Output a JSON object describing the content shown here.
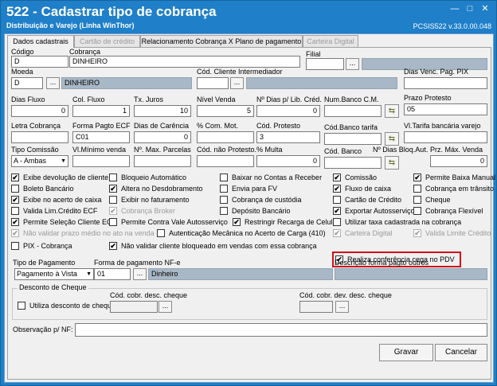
{
  "window": {
    "title": "522 - Cadastrar tipo de cobrança",
    "subtitle": "Distribuição e Varejo (Linha WinThor)",
    "version": "PCSIS522  v.33.0.00.048",
    "minimize": "—",
    "maximize": "□",
    "close": "✕"
  },
  "tabs": [
    "Dados cadastrais",
    "Cartão de crédito",
    "Relacionamento Cobrança X Plano de pagamento",
    "Carteira Digital"
  ],
  "fields": {
    "codigo": {
      "label": "Código",
      "value": "D"
    },
    "cobranca": {
      "label": "Cobrança",
      "value": "DINHEIRO"
    },
    "filial": {
      "label": "Filial",
      "value": ""
    },
    "moeda": {
      "label": "Moeda",
      "value": "D",
      "desc": "DINHEIRO"
    },
    "cod_cliente_inter": {
      "label": "Cód. Cliente Intermediador",
      "value": ""
    },
    "dias_venc": {
      "label": "Dias Venc. Pag. PIX",
      "value": ""
    },
    "dias_fluxo": {
      "label": "Dias Fluxo",
      "value": "0"
    },
    "col_fluxo": {
      "label": "Col. Fluxo",
      "value": "1"
    },
    "tx_juros": {
      "label": "Tx. Juros",
      "value": "10"
    },
    "nivel_venda": {
      "label": "Nível Venda",
      "value": "5"
    },
    "n_dias_lib": {
      "label": "Nº Dias p/ Lib. Créd.",
      "value": "0"
    },
    "num_banco_cm": {
      "label": "Num.Banco C.M.",
      "value": ""
    },
    "prazo_protesto": {
      "label": "Prazo Protesto",
      "value": "05"
    },
    "letra_cobranca": {
      "label": "Letra Cobrança",
      "value": ""
    },
    "forma_pagto_ecf": {
      "label": "Forma Pagto ECF",
      "value": "C01"
    },
    "dias_carencia": {
      "label": "Dias de Carência",
      "value": "0"
    },
    "com_mot": {
      "label": "% Com. Mot.",
      "value": ""
    },
    "cod_protesto": {
      "label": "Cód. Protesto",
      "value": "3"
    },
    "cod_banco_tarifa": {
      "label": "Cód.Banco tarifa",
      "value": ""
    },
    "vl_tarifa": {
      "label": "Vl.Tarifa bancária varejo",
      "value": ""
    },
    "tipo_comissao": {
      "label": "Tipo Comissão",
      "value": "A - Ambas"
    },
    "vl_minimo_venda": {
      "label": "Vl.Mínimo venda",
      "value": ""
    },
    "n_max_parcelas": {
      "label": "Nº. Max. Parcelas",
      "value": ""
    },
    "cod_nao_protesto": {
      "label": "Cód. não Protesto.",
      "value": ""
    },
    "multa": {
      "label": "% Multa",
      "value": "0"
    },
    "cod_banco": {
      "label": "Cód. Banco",
      "value": ""
    },
    "n_dias_bloq": {
      "label": "Nº Dias Bloq.Aut.",
      "value": ""
    },
    "prz_max_venda": {
      "label": "Prz. Máx. Venda",
      "value": "0"
    }
  },
  "checkboxes": [
    {
      "label": "Exibe devolução de cliente",
      "checked": true,
      "disabled": false
    },
    {
      "label": "Boleto Bancário",
      "checked": false,
      "disabled": false
    },
    {
      "label": "Exibe no acerto de caixa",
      "checked": true,
      "disabled": false
    },
    {
      "label": "Valida Lim.Crédito ECF",
      "checked": false,
      "disabled": false
    },
    {
      "label": "Permite Seleção Cliente ECF",
      "checked": true,
      "disabled": false
    },
    {
      "label": "Não validar prazo médio no ato na venda",
      "checked": true,
      "disabled": true
    },
    {
      "label": "PIX - Cobrança",
      "checked": false,
      "disabled": false
    },
    {
      "label": "Bloqueio Automático",
      "checked": false,
      "disabled": false
    },
    {
      "label": "Altera no Desdobramento",
      "checked": true,
      "disabled": false
    },
    {
      "label": "Exibir no faturamento",
      "checked": false,
      "disabled": false
    },
    {
      "label": "Cobrança Broker",
      "checked": true,
      "disabled": true
    },
    {
      "label": "Permite Contra Vale Autosserviço",
      "checked": false,
      "disabled": false
    },
    {
      "label": "Autenticação Mecânica no Acerto de Carga (410)",
      "checked": false,
      "disabled": false
    },
    {
      "label": "Não validar cliente bloqueado em vendas com essa cobrança",
      "checked": true,
      "disabled": false
    },
    {
      "label": "Baixar no Contas a Receber",
      "checked": false,
      "disabled": false
    },
    {
      "label": "Envia para FV",
      "checked": false,
      "disabled": false
    },
    {
      "label": "Cobrança de custódia",
      "checked": false,
      "disabled": false
    },
    {
      "label": "Depósito Bancário",
      "checked": false,
      "disabled": false
    },
    {
      "label": "Restringir Recarga de Celular",
      "checked": true,
      "disabled": false
    },
    {
      "label": "Comissão",
      "checked": true,
      "disabled": false
    },
    {
      "label": "Fluxo de caixa",
      "checked": true,
      "disabled": false
    },
    {
      "label": "Cartão de Crédito",
      "checked": false,
      "disabled": false
    },
    {
      "label": "Exportar Autosserviço",
      "checked": true,
      "disabled": false
    },
    {
      "label": "Utilizar taxa cadastrada na cobrança",
      "checked": false,
      "disabled": false
    },
    {
      "label": "Carteira Digital",
      "checked": true,
      "disabled": true
    },
    {
      "label": "Realiza conferência cega no PDV",
      "checked": true,
      "disabled": false
    },
    {
      "label": "Permite Baixa Manual",
      "checked": true,
      "disabled": false
    },
    {
      "label": "Cobrança em trânsito",
      "checked": false,
      "disabled": false
    },
    {
      "label": "Cheque",
      "checked": false,
      "disabled": false
    },
    {
      "label": "Cobrança Flexível",
      "checked": false,
      "disabled": false
    },
    {
      "label": "Valida Limite Crédito",
      "checked": true,
      "disabled": true
    }
  ],
  "pagamento": {
    "tipo_label": "Tipo de Pagamento",
    "tipo_value": "Pagamento à Vista",
    "forma_label": "Forma de pagamento NF-e",
    "forma_code": "01",
    "forma_desc": "Dinheiro",
    "desc_outros_label": "Descrição forma pagto outros",
    "desc_outros_value": ""
  },
  "cheque": {
    "group_label": "Desconto de Cheque",
    "utiliza_label": "Utiliza desconto de cheque",
    "cod_desc_label": "Cód. cobr. desc. cheque",
    "cod_dev_label": "Cód. cobr. dev. desc. cheque"
  },
  "obs": {
    "label": "Observação p/ NF:",
    "value": ""
  },
  "buttons": {
    "lookup": "...",
    "save": "Gravar",
    "cancel": "Cancelar",
    "icon": "⇆"
  }
}
